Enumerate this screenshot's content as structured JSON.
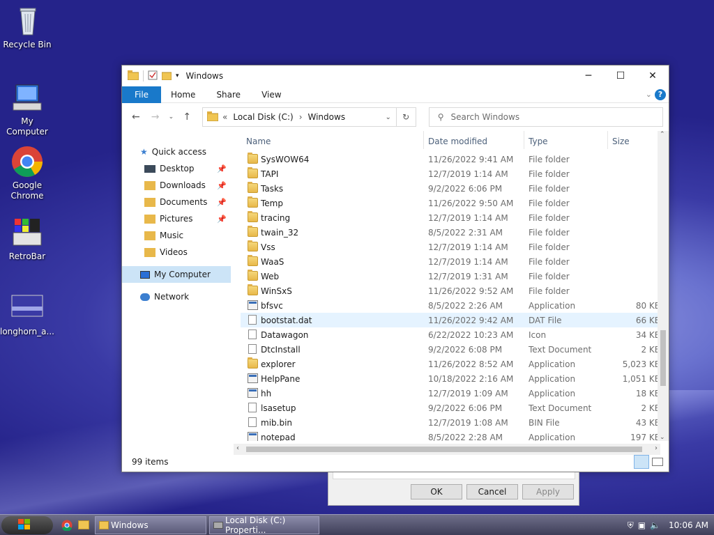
{
  "desktop": {
    "icons": [
      "Recycle Bin",
      "My Computer",
      "Google Chrome",
      "RetroBar",
      "longhorn_a..."
    ]
  },
  "window": {
    "title": "Windows",
    "ribbon_tabs": [
      "File",
      "Home",
      "Share",
      "View"
    ],
    "address": {
      "root": "Local Disk (C:)",
      "folder": "Windows",
      "prefix": "«",
      "sep": "›"
    },
    "search_placeholder": "Search Windows",
    "nav": {
      "quick_access": "Quick access",
      "items": [
        "Desktop",
        "Downloads",
        "Documents",
        "Pictures",
        "Music",
        "Videos"
      ],
      "my_computer": "My Computer",
      "network": "Network"
    },
    "columns": {
      "name": "Name",
      "date": "Date modified",
      "type": "Type",
      "size": "Size"
    },
    "files": [
      {
        "name": "SysWOW64",
        "date": "11/26/2022 9:41 AM",
        "type": "File folder",
        "size": "",
        "icon": "folder"
      },
      {
        "name": "TAPI",
        "date": "12/7/2019 1:14 AM",
        "type": "File folder",
        "size": "",
        "icon": "folder"
      },
      {
        "name": "Tasks",
        "date": "9/2/2022 6:06 PM",
        "type": "File folder",
        "size": "",
        "icon": "folder"
      },
      {
        "name": "Temp",
        "date": "11/26/2022 9:50 AM",
        "type": "File folder",
        "size": "",
        "icon": "folder"
      },
      {
        "name": "tracing",
        "date": "12/7/2019 1:14 AM",
        "type": "File folder",
        "size": "",
        "icon": "folder"
      },
      {
        "name": "twain_32",
        "date": "8/5/2022 2:31 AM",
        "type": "File folder",
        "size": "",
        "icon": "folder"
      },
      {
        "name": "Vss",
        "date": "12/7/2019 1:14 AM",
        "type": "File folder",
        "size": "",
        "icon": "folder"
      },
      {
        "name": "WaaS",
        "date": "12/7/2019 1:14 AM",
        "type": "File folder",
        "size": "",
        "icon": "folder"
      },
      {
        "name": "Web",
        "date": "12/7/2019 1:31 AM",
        "type": "File folder",
        "size": "",
        "icon": "folder"
      },
      {
        "name": "WinSxS",
        "date": "11/26/2022 9:52 AM",
        "type": "File folder",
        "size": "",
        "icon": "folder"
      },
      {
        "name": "bfsvc",
        "date": "8/5/2022 2:26 AM",
        "type": "Application",
        "size": "80 KB",
        "icon": "app"
      },
      {
        "name": "bootstat.dat",
        "date": "11/26/2022 9:42 AM",
        "type": "DAT File",
        "size": "66 KB",
        "icon": "doc"
      },
      {
        "name": "Datawagon",
        "date": "6/22/2022 10:23 AM",
        "type": "Icon",
        "size": "34 KB",
        "icon": "doc"
      },
      {
        "name": "DtcInstall",
        "date": "9/2/2022 6:08 PM",
        "type": "Text Document",
        "size": "2 KB",
        "icon": "doc"
      },
      {
        "name": "explorer",
        "date": "11/26/2022 8:52 AM",
        "type": "Application",
        "size": "5,023 KB",
        "icon": "folder"
      },
      {
        "name": "HelpPane",
        "date": "10/18/2022 2:16 AM",
        "type": "Application",
        "size": "1,051 KB",
        "icon": "app"
      },
      {
        "name": "hh",
        "date": "12/7/2019 1:09 AM",
        "type": "Application",
        "size": "18 KB",
        "icon": "app"
      },
      {
        "name": "lsasetup",
        "date": "9/2/2022 6:06 PM",
        "type": "Text Document",
        "size": "2 KB",
        "icon": "doc"
      },
      {
        "name": "mib.bin",
        "date": "12/7/2019 1:08 AM",
        "type": "BIN File",
        "size": "43 KB",
        "icon": "doc"
      },
      {
        "name": "notepad",
        "date": "8/5/2022 2:28 AM",
        "type": "Application",
        "size": "197 KB",
        "icon": "app"
      }
    ],
    "status": "99 items"
  },
  "dialog": {
    "ok": "OK",
    "cancel": "Cancel",
    "apply": "Apply"
  },
  "taskbar": {
    "buttons": [
      "Windows",
      "Local Disk (C:) Properti..."
    ],
    "clock": "10:06 AM"
  },
  "colors": {
    "accent": "#1979ca",
    "selection": "#cce4f7",
    "hover": "#e5f3ff"
  }
}
